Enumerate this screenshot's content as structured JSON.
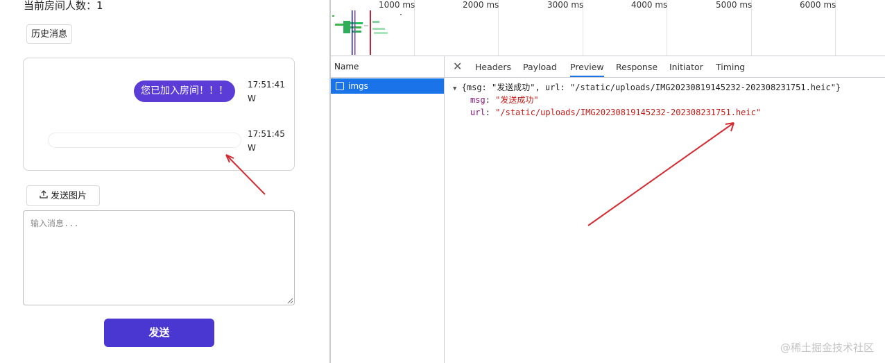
{
  "chat": {
    "room_count_label": "当前房间人数：1",
    "history_button": "历史消息",
    "messages": [
      {
        "text": "您已加入房间！！！",
        "time": "17:51:41",
        "sender": "W"
      },
      {
        "text": "",
        "time": "17:51:45",
        "sender": "W"
      }
    ],
    "upload_button": "发送图片",
    "input_placeholder": "输入消息...",
    "send_button": "发送"
  },
  "devtools": {
    "timeline_ticks": [
      "1000 ms",
      "2000 ms",
      "3000 ms",
      "4000 ms",
      "5000 ms",
      "6000 ms"
    ],
    "name_column_header": "Name",
    "request_name": "imgs",
    "tabs": [
      "Headers",
      "Payload",
      "Preview",
      "Response",
      "Initiator",
      "Timing"
    ],
    "active_tab": "Preview",
    "preview": {
      "summary": "{msg: \"发送成功\", url: \"/static/uploads/IMG20230819145232-202308231751.heic\"}",
      "msg_key": "msg",
      "msg_value": "\"发送成功\"",
      "url_key": "url",
      "url_value": "\"/static/uploads/IMG20230819145232-202308231751.heic\""
    }
  },
  "watermark": "@稀土掘金技术社区",
  "colors": {
    "bubble": "#5b3cd6",
    "send": "#4a36d1",
    "selected_row": "#1a73e8",
    "annotation_arrow": "#d42a30"
  }
}
